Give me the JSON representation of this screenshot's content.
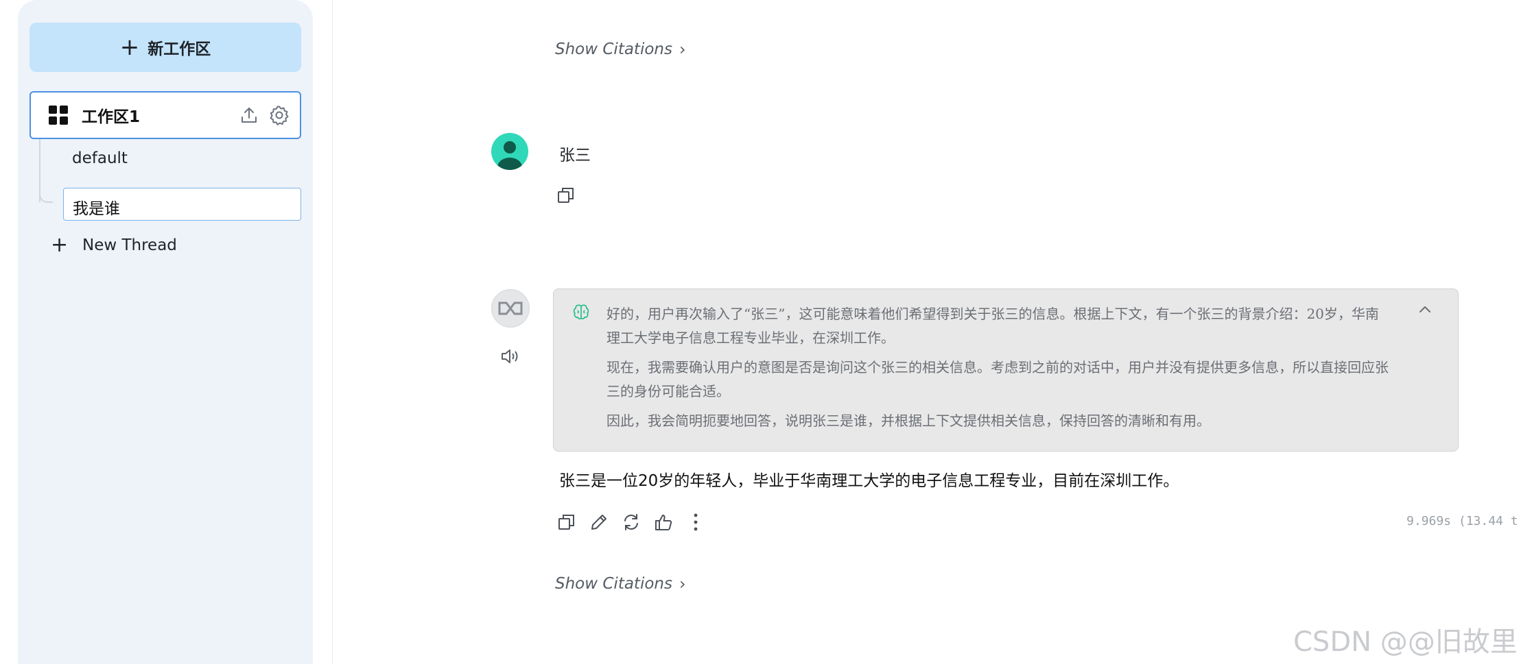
{
  "sidebar": {
    "new_workspace_label": "新工作区",
    "workspace": {
      "name": "工作区1",
      "threads": [
        {
          "label": "default"
        },
        {
          "label": "我是谁",
          "active": true
        }
      ]
    },
    "new_thread_label": "New Thread"
  },
  "chat": {
    "citations_label": "Show Citations",
    "user_message": {
      "name": "张三"
    },
    "assistant_message": {
      "thinking": [
        "好的，用户再次输入了“张三”，这可能意味着他们希望得到关于张三的信息。根据上下文，有一个张三的背景介绍：20岁，华南理工大学电子信息工程专业毕业，在深圳工作。",
        "现在，我需要确认用户的意图是否是询问这个张三的相关信息。考虑到之前的对话中，用户并没有提供更多信息，所以直接回应张三的身份可能合适。",
        "因此，我会简明扼要地回答，说明张三是谁，并根据上下文提供相关信息，保持回答的清晰和有用。"
      ],
      "answer": "张三是一位20岁的年轻人，毕业于华南理工大学的电子信息工程专业，目前在深圳工作。",
      "timing": "9.969s (13.44 t"
    }
  },
  "watermark": "CSDN @@旧故里",
  "colors": {
    "sidebar_bg": "#eef2f9",
    "accent_button": "#c3e4fb",
    "active_border": "#4a90e2",
    "user_avatar": "#2fd8b8",
    "thinking_bg": "#e8e8e8"
  }
}
